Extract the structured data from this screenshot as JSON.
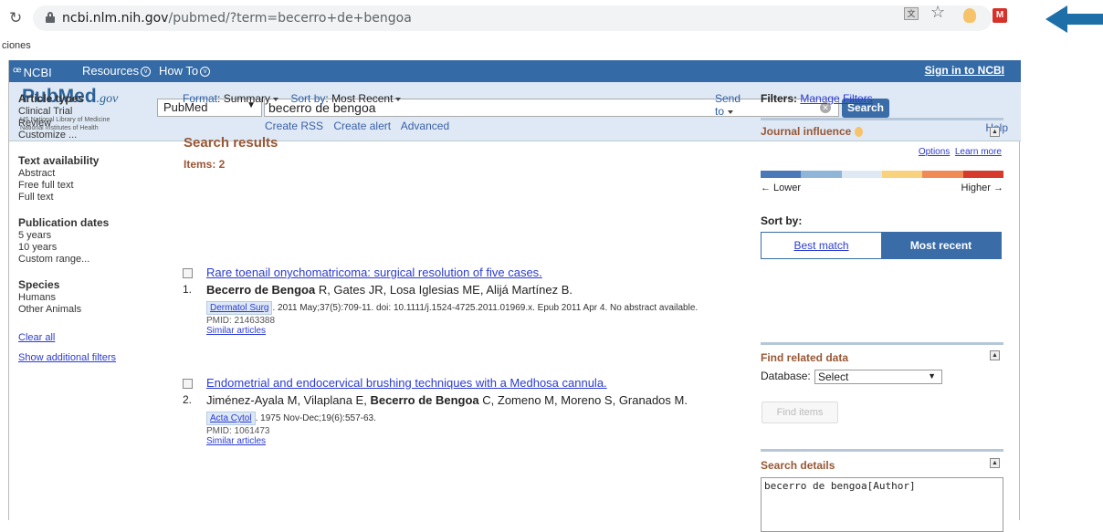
{
  "browser": {
    "url_host": "ncbi.nlm.nih.gov",
    "url_path": "/pubmed/?term=becerro+de+bengoa",
    "bookmark_partial": "ciones"
  },
  "ncbi_bar": {
    "logo": "NCBI",
    "resources": "Resources",
    "howto": "How To",
    "signin": "Sign in to NCBI"
  },
  "header": {
    "logo_pub": "Pub",
    "logo_med": "Med",
    "logo_gov": ".gov",
    "org1": "US National Library of Medicine",
    "org2": "National Institutes of Health",
    "db": "PubMed",
    "query": "becerro de bengoa",
    "search_btn": "Search",
    "links": [
      "Create RSS",
      "Create alert",
      "Advanced"
    ],
    "help": "Help"
  },
  "sidebar": {
    "groups": [
      {
        "title": "Article types",
        "items": [
          "Clinical Trial",
          "Review",
          "Customize ..."
        ]
      },
      {
        "title": "Text availability",
        "items": [
          "Abstract",
          "Free full text",
          "Full text"
        ]
      },
      {
        "title": "Publication dates",
        "items": [
          "5 years",
          "10 years",
          "Custom range..."
        ]
      },
      {
        "title": "Species",
        "items": [
          "Humans",
          "Other Animals"
        ]
      }
    ],
    "clear_all": "Clear all",
    "show_filters": "Show additional filters"
  },
  "toolbar": {
    "format_label": "Format",
    "format_value": "Summary",
    "sort_label": "Sort by",
    "sort_value": "Most Recent",
    "send_to": "Send to"
  },
  "results": {
    "title": "Search results",
    "items": "Items: 2",
    "list": [
      {
        "num": "1.",
        "title": "Rare toenail onychomatricoma: surgical resolution of five cases.",
        "author_bold": "Becerro de Bengoa",
        "author_rest": " R, Gates JR, Losa Iglesias ME, Alijá Martínez B.",
        "journal": "Dermatol Surg",
        "cite": ". 2011 May;37(5):709-11. doi: 10.1111/j.1524-4725.2011.01969.x. Epub 2011 Apr 4. No abstract available.",
        "pmid": "PMID: 21463388",
        "similar": "Similar articles"
      },
      {
        "num": "2.",
        "title": "Endometrial and endocervical brushing techniques with a Medhosa cannula.",
        "author_pre": "Jiménez-Ayala M, Vilaplana E, ",
        "author_bold": "Becerro de Bengoa",
        "author_rest": " C, Zomeno M, Moreno S, Granados M.",
        "journal": "Acta Cytol",
        "cite": ". 1975 Nov-Dec;19(6):557-63.",
        "pmid": "PMID: 1061473",
        "similar": "Similar articles"
      }
    ]
  },
  "right": {
    "filters_label": "Filters:",
    "manage_filters": "Manage Filters",
    "journal_influence": "Journal influence",
    "options": "Options",
    "learn_more": "Learn more",
    "lower": "← Lower",
    "higher": "Higher →",
    "scale_colors": [
      "#4a78b8",
      "#8fb6d9",
      "#dfe9f3",
      "#f8d27d",
      "#f08a56",
      "#d53a2c"
    ],
    "sort_by": "Sort by:",
    "best_match": "Best match",
    "most_recent": "Most recent",
    "find_related": "Find related data",
    "database_label": "Database:",
    "database_value": "Select",
    "find_items": "Find items",
    "search_details": "Search details",
    "details_text": "becerro de bengoa[Author]"
  }
}
